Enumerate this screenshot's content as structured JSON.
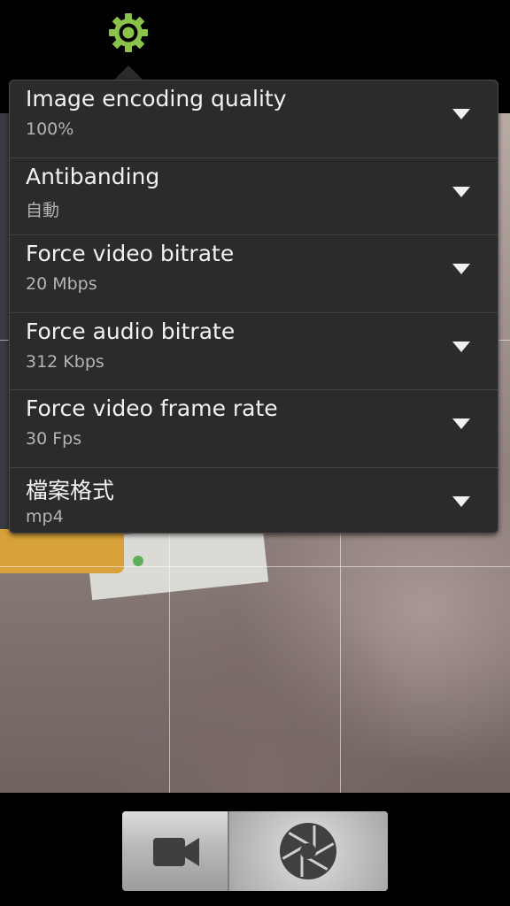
{
  "top_bar": {
    "settings_icon": "gear-icon",
    "settings_icon_color": "#8bc34a"
  },
  "settings_menu": {
    "dropdown_icon": "triangle-down-icon",
    "items": [
      {
        "title": "Image encoding quality",
        "value": "100%"
      },
      {
        "title": "Antibanding",
        "value": "自動"
      },
      {
        "title": "Force video bitrate",
        "value": "20 Mbps"
      },
      {
        "title": "Force audio bitrate",
        "value": "312 Kbps"
      },
      {
        "title": "Force video frame rate",
        "value": "30 Fps"
      },
      {
        "title": "檔案格式",
        "value": "mp4"
      }
    ]
  },
  "bottom_bar": {
    "video_mode_icon": "video-camera-icon",
    "shutter_icon": "aperture-icon"
  }
}
